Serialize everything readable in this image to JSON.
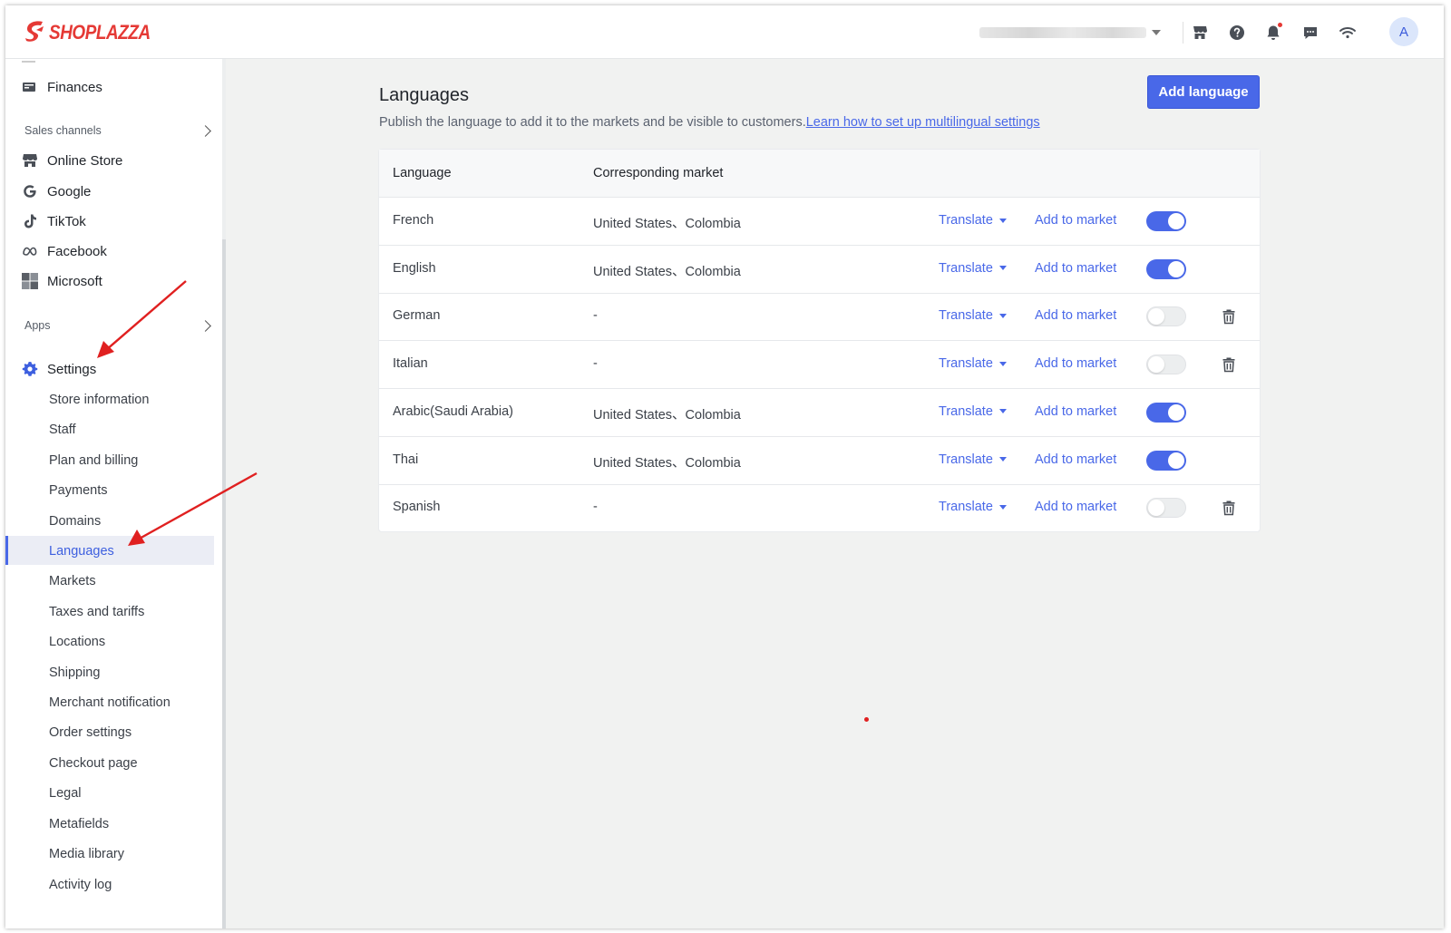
{
  "brand": {
    "name": "SHOPLAZZA",
    "color": "#e53935"
  },
  "topbar": {
    "icons": [
      "store-icon",
      "help-icon",
      "bell-icon",
      "chat-icon",
      "wifi-icon"
    ],
    "avatar_initial": "A"
  },
  "sidebar": {
    "partial_item": "Finances",
    "sales_channels_label": "Sales channels",
    "channels": [
      "Online Store",
      "Google",
      "TikTok",
      "Facebook",
      "Microsoft"
    ],
    "apps_label": "Apps",
    "settings_label": "Settings",
    "settings_items": [
      "Store information",
      "Staff",
      "Plan and billing",
      "Payments",
      "Domains",
      "Languages",
      "Markets",
      "Taxes and tariffs",
      "Locations",
      "Shipping",
      "Merchant notification",
      "Order settings",
      "Checkout page",
      "Legal",
      "Metafields",
      "Media library",
      "Activity log"
    ],
    "active_item": "Languages"
  },
  "main": {
    "title": "Languages",
    "subtitle": "Publish the language to add it to the markets and be visible to customers.",
    "help_link": "Learn how to set up multilingual settings",
    "add_button": "Add language",
    "columns": {
      "language": "Language",
      "market": "Corresponding market"
    },
    "translate_label": "Translate",
    "add_to_market_label": "Add to market",
    "rows": [
      {
        "language": "French",
        "market": "United States、Colombia",
        "published": true,
        "deletable": false
      },
      {
        "language": "English",
        "market": "United States、Colombia",
        "published": true,
        "deletable": false
      },
      {
        "language": "German",
        "market": "-",
        "published": false,
        "deletable": true
      },
      {
        "language": "Italian",
        "market": "-",
        "published": false,
        "deletable": true
      },
      {
        "language": "Arabic(Saudi Arabia)",
        "market": "United States、Colombia",
        "published": true,
        "deletable": false
      },
      {
        "language": "Thai",
        "market": "United States、Colombia",
        "published": true,
        "deletable": false
      },
      {
        "language": "Spanish",
        "market": "-",
        "published": false,
        "deletable": true
      }
    ]
  },
  "colors": {
    "accent": "#4968e8",
    "annotation": "#e02020"
  }
}
